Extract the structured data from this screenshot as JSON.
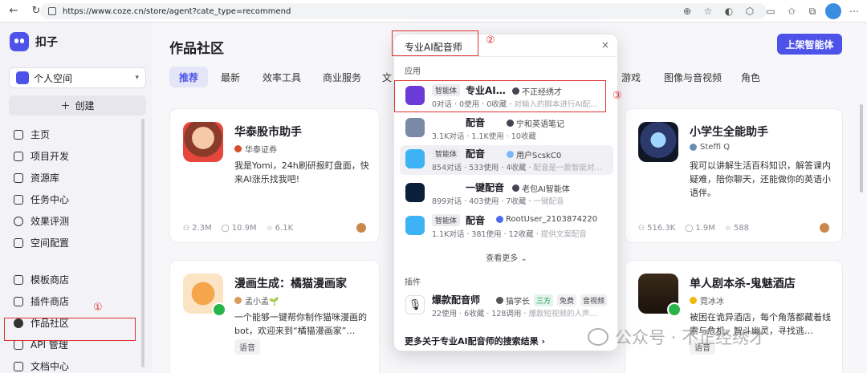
{
  "browser": {
    "url": "https://www.coze.cn/store/agent?cate_type=recommend"
  },
  "sidebar": {
    "brand": "扣子",
    "space": "个人空间",
    "create": "创建",
    "items": [
      {
        "label": "主页",
        "icon": "home-icon"
      },
      {
        "label": "项目开发",
        "icon": "project-icon"
      },
      {
        "label": "资源库",
        "icon": "library-icon"
      },
      {
        "label": "任务中心",
        "icon": "task-icon"
      },
      {
        "label": "效果评测",
        "icon": "evaluate-icon"
      },
      {
        "label": "空间配置",
        "icon": "config-icon"
      },
      {
        "label": "模板商店",
        "icon": "template-icon"
      },
      {
        "label": "插件商店",
        "icon": "plugin-icon"
      },
      {
        "label": "作品社区",
        "icon": "community-icon"
      },
      {
        "label": "API 管理",
        "icon": "api-icon"
      },
      {
        "label": "文档中心",
        "icon": "doc-icon"
      }
    ]
  },
  "annotations": {
    "a1": "①",
    "a2": "②",
    "a3": "③"
  },
  "main": {
    "title": "作品社区",
    "publish": "上架智能体",
    "tabs": [
      "推荐",
      "最新",
      "效率工具",
      "商业服务",
      "文",
      "游戏",
      "图像与音视频",
      "角色"
    ]
  },
  "cards": [
    {
      "title": "华泰股市助手",
      "author": "华泰证券",
      "desc": "我是Yomi，24h刷研报盯盘面，快来AI涨乐找我吧!",
      "stats": [
        "2.3M",
        "10.9M",
        "6.1K"
      ]
    },
    {
      "title": "小学生全能助手",
      "author": "Steffi Q",
      "desc": "我可以讲解生活百科知识，解答课内疑难，陪你聊天，还能做你的英语小语伴。",
      "stats": [
        "516.3K",
        "1.9M",
        "588"
      ]
    },
    {
      "title": "漫画生成：橘猫漫画家",
      "author": "孟小孟🌱",
      "desc": "一个能够一键帮你制作猫咪漫画的bot，欢迎来到“橘猫漫画家”…",
      "tag": "语音"
    },
    {
      "title": "单人剧本杀-鬼魅酒店",
      "author": "霓冰冰",
      "desc": "被困在诡异酒店，每个角落都藏着线索与危机。智斗幽灵，寻找逃…",
      "tag": "语音"
    }
  ],
  "search": {
    "query": "专业AI配音师",
    "section_apps": "应用",
    "results": [
      {
        "badge": "智能体",
        "name": "专业AI…",
        "author": "不正经绣才",
        "meta": "0对话 · 0使用 · 0收藏",
        "desc": "对输入的脚本进行AI配…"
      },
      {
        "badge": "",
        "name": "配音",
        "author": "宁和英语笔记",
        "meta": "3.1K对话 · 1.1K使用 · 10收藏",
        "desc": ""
      },
      {
        "badge": "智能体",
        "name": "配音",
        "author": "用户ScskC0",
        "meta": "854对话 · 533使用 · 4收藏",
        "desc": "配音是一款智能对…"
      },
      {
        "badge": "",
        "name": "一键配音",
        "author": "老包AI智能体",
        "meta": "899对话 · 403使用 · 7收藏",
        "desc": "一键配音"
      },
      {
        "badge": "智能体",
        "name": "配音",
        "author": "RootUser_2103874220",
        "meta": "1.1K对话 · 381使用 · 12收藏",
        "desc": "提供文案配音"
      }
    ],
    "see_more": "查看更多",
    "section_plugins": "插件",
    "plugin": {
      "name": "爆款配音师",
      "author": "猫学长",
      "tags": [
        "三方",
        "免费",
        "音视频"
      ],
      "meta": "22使用 · 6收藏 · 128调用",
      "desc": "爆款短视频的人声…"
    },
    "more_results": "更多关于专业AI配音师的搜索结果"
  },
  "watermark": "公众号 · 不正经绣才"
}
